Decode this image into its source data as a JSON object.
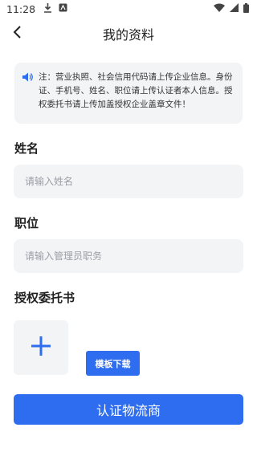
{
  "status_bar": {
    "time": "11:28"
  },
  "header": {
    "title": "我的资料"
  },
  "notice": {
    "text": "注：营业执照、社会信用代码请上传企业信息。身份证、手机号、姓名、职位请上传认证者本人信息。授权委托书请上传加盖授权企业盖章文件！"
  },
  "form": {
    "name_label": "姓名",
    "name_placeholder": "请输入姓名",
    "position_label": "职位",
    "position_placeholder": "请输入管理员职务",
    "authorization_label": "授权委托书",
    "template_download_label": "模板下载",
    "submit_label": "认证物流商"
  },
  "colors": {
    "accent": "#2f6df0",
    "field_bg": "#f3f4f6"
  },
  "icons": [
    "download-icon",
    "app-notification-icon",
    "wifi-icon",
    "signal-icon",
    "battery-icon",
    "back-arrow-icon",
    "speaker-icon",
    "plus-icon"
  ]
}
